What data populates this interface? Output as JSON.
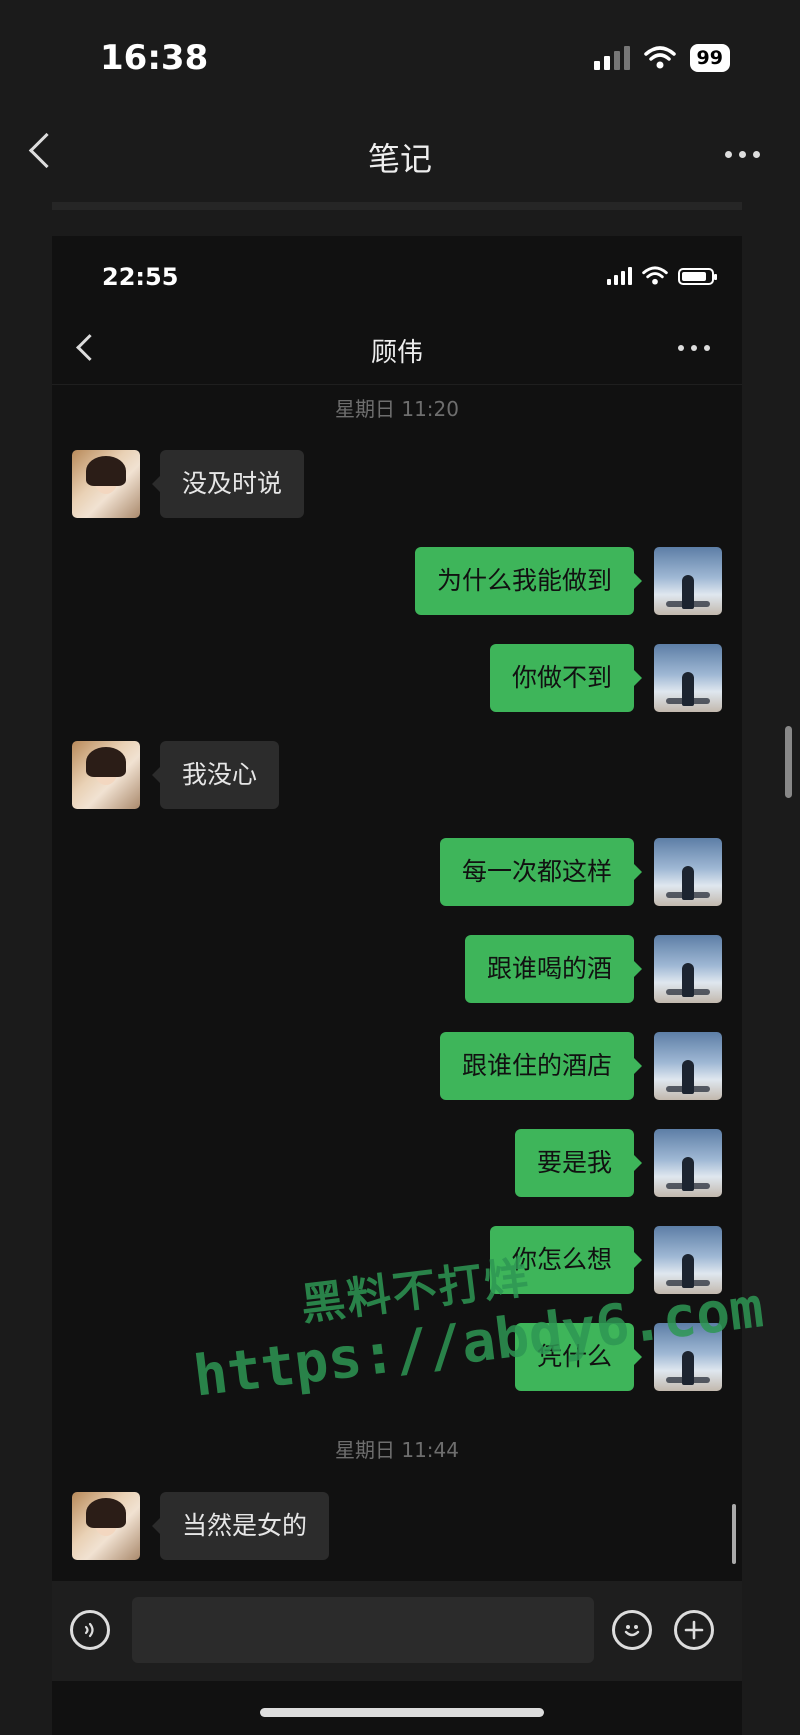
{
  "outer": {
    "time": "16:38",
    "battery": "99",
    "title": "笔记"
  },
  "screenshot": {
    "time": "22:55",
    "contact_name": "顾伟",
    "timestamps": [
      "星期日 11:20",
      "星期日 11:44"
    ],
    "messages": [
      {
        "side": "left",
        "text": "没及时说"
      },
      {
        "side": "right",
        "text": "为什么我能做到"
      },
      {
        "side": "right",
        "text": "你做不到"
      },
      {
        "side": "left",
        "text": "我没心"
      },
      {
        "side": "right",
        "text": "每一次都这样"
      },
      {
        "side": "right",
        "text": "跟谁喝的酒"
      },
      {
        "side": "right",
        "text": "跟谁住的酒店"
      },
      {
        "side": "right",
        "text": "要是我"
      },
      {
        "side": "right",
        "text": "你怎么想"
      },
      {
        "side": "right",
        "text": "凭什么"
      },
      {
        "side": "left",
        "text": "当然是女的"
      }
    ],
    "input": {
      "voice_icon": "voice-icon",
      "emoji_icon": "emoji-icon",
      "plus_icon": "plus-icon"
    }
  },
  "watermark": {
    "line1": "黑料不打烊",
    "line2": "https://abdy6.com"
  },
  "colors": {
    "bubble_green": "#3eb55a",
    "bubble_dark": "#2c2c2c"
  }
}
